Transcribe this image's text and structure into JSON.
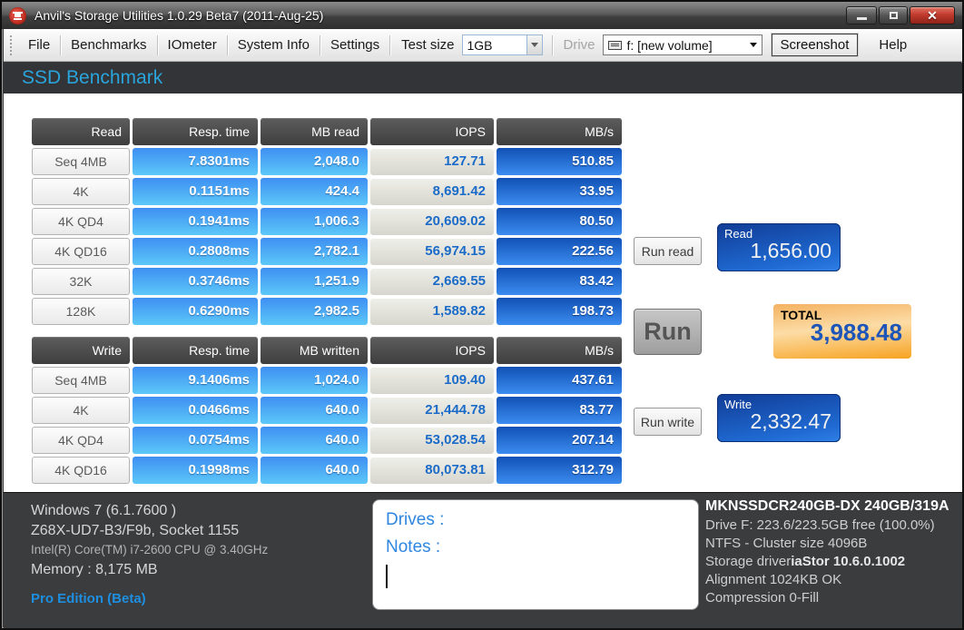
{
  "window": {
    "title": "Anvil's Storage Utilities 1.0.29 Beta7 (2011-Aug-25)"
  },
  "menu": {
    "items": [
      "File",
      "Benchmarks",
      "IOmeter",
      "System Info",
      "Settings"
    ],
    "test_size_label": "Test size",
    "test_size_value": "1GB",
    "drive_label": "Drive",
    "drive_value": "f: [new volume]",
    "screenshot_label": "Screenshot",
    "help_label": "Help"
  },
  "page_title": "SSD Benchmark",
  "read_table": {
    "headers": [
      "Read",
      "Resp. time",
      "MB read",
      "IOPS",
      "MB/s"
    ],
    "rows": [
      {
        "label": "Seq 4MB",
        "resp_time": "7.8301ms",
        "mb": "2,048.0",
        "iops": "127.71",
        "mbs": "510.85"
      },
      {
        "label": "4K",
        "resp_time": "0.1151ms",
        "mb": "424.4",
        "iops": "8,691.42",
        "mbs": "33.95"
      },
      {
        "label": "4K QD4",
        "resp_time": "0.1941ms",
        "mb": "1,006.3",
        "iops": "20,609.02",
        "mbs": "80.50"
      },
      {
        "label": "4K QD16",
        "resp_time": "0.2808ms",
        "mb": "2,782.1",
        "iops": "56,974.15",
        "mbs": "222.56"
      },
      {
        "label": "32K",
        "resp_time": "0.3746ms",
        "mb": "1,251.9",
        "iops": "2,669.55",
        "mbs": "83.42"
      },
      {
        "label": "128K",
        "resp_time": "0.6290ms",
        "mb": "2,982.5",
        "iops": "1,589.82",
        "mbs": "198.73"
      }
    ]
  },
  "write_table": {
    "headers": [
      "Write",
      "Resp. time",
      "MB written",
      "IOPS",
      "MB/s"
    ],
    "rows": [
      {
        "label": "Seq 4MB",
        "resp_time": "9.1406ms",
        "mb": "1,024.0",
        "iops": "109.40",
        "mbs": "437.61"
      },
      {
        "label": "4K",
        "resp_time": "0.0466ms",
        "mb": "640.0",
        "iops": "21,444.78",
        "mbs": "83.77"
      },
      {
        "label": "4K QD4",
        "resp_time": "0.0754ms",
        "mb": "640.0",
        "iops": "53,028.54",
        "mbs": "207.14"
      },
      {
        "label": "4K QD16",
        "resp_time": "0.1998ms",
        "mb": "640.0",
        "iops": "80,073.81",
        "mbs": "312.79"
      }
    ]
  },
  "actions": {
    "run_read": "Run read",
    "run": "Run",
    "run_write": "Run write"
  },
  "scores": {
    "read": {
      "label": "Read",
      "value": "1,656.00"
    },
    "total": {
      "label": "TOTAL",
      "value": "3,988.48"
    },
    "write": {
      "label": "Write",
      "value": "2,332.47"
    }
  },
  "system_info": {
    "os": "Windows 7 (6.1.7600 )",
    "board": "Z68X-UD7-B3/F9b, Socket 1155",
    "cpu": "Intel(R) Core(TM) i7-2600 CPU @ 3.40GHz",
    "memory": "Memory : 8,175 MB",
    "edition": "Pro Edition (Beta)"
  },
  "notes_box": {
    "drives_label": "Drives :",
    "notes_label": "Notes :"
  },
  "drive_info": {
    "model": "MKNSSDCR240GB-DX 240GB/319A",
    "capacity": "Drive F: 223.6/223.5GB free (100.0%)",
    "filesystem": "NTFS - Cluster size 4096B",
    "storage_driver_label": "Storage driver",
    "storage_driver_value": "iaStor 10.6.0.1002",
    "alignment": "Alignment 1024KB OK",
    "compression": "Compression 0-Fill"
  },
  "colors": {
    "accent_blue": "#2aa4dc",
    "cell_light_blue": "#4292f0",
    "cell_dark_blue": "#1151b5",
    "score_blue": "#1f6ad2",
    "total_orange": "#f7a321",
    "close_red": "#c23b2e"
  }
}
